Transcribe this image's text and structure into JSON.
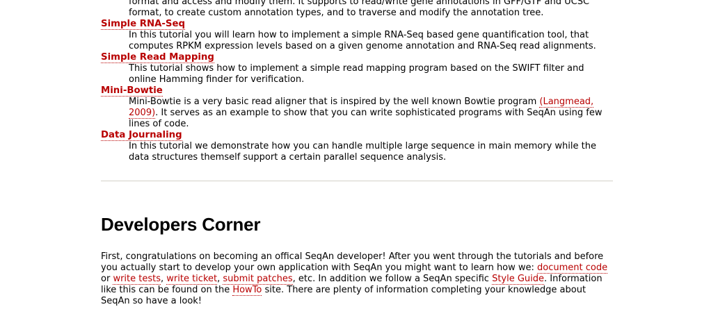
{
  "top_partial": {
    "line1": "format and access and modify them. It supports to read/write gene annotations in GFF/GTF and UCSC",
    "line2": "format, to create custom annotation types, and to traverse and modify the annotation tree."
  },
  "tutorials": [
    {
      "title": "Simple RNA-Seq",
      "description": "In this tutorial you will learn how to implement a simple RNA-Seq based gene quantification tool, that computes RPKM expression levels based on a given genome annotation and RNA-Seq read alignments."
    },
    {
      "title": "Simple Read Mapping",
      "description": "This tutorial shows how to implement a simple read mapping program based on the SWIFT filter and online Hamming finder for verification."
    },
    {
      "title": "Mini-Bowtie",
      "description_before": "Mini-Bowtie is a very basic read aligner that is inspired by the well known Bowtie program ",
      "citation": "(Langmead, 2009)",
      "description_after": ". It serves as an example to show that you can write sophisticated programs with SeqAn using few lines of code."
    },
    {
      "title": "Data Journaling",
      "description": "In this tutorial we demonstrate how you can handle multiple large sequence in main memory while the data structures themself support a certain parallel sequence analysis."
    }
  ],
  "developers": {
    "heading": "Developers Corner",
    "text1": "First, congratulations on becoming an offical SeqAn developer! After you went through the tutorials and before you actually start to develop your own application with SeqAn you might want to learn how we: ",
    "link_document_code": "document code",
    "text2": " or ",
    "link_write_tests": "write tests",
    "text3": ", ",
    "link_write_ticket": "write ticket",
    "text4": ", ",
    "link_submit_patches": "submit patches",
    "text5": ", etc. In addition we follow a SeqAn specific ",
    "link_style_guide": "Style Guide",
    "text6": ". Information like this can be found on the ",
    "link_howto": "HowTo",
    "text7": " site. There are plenty of information completing your knowledge about SeqAn so have a look!"
  }
}
